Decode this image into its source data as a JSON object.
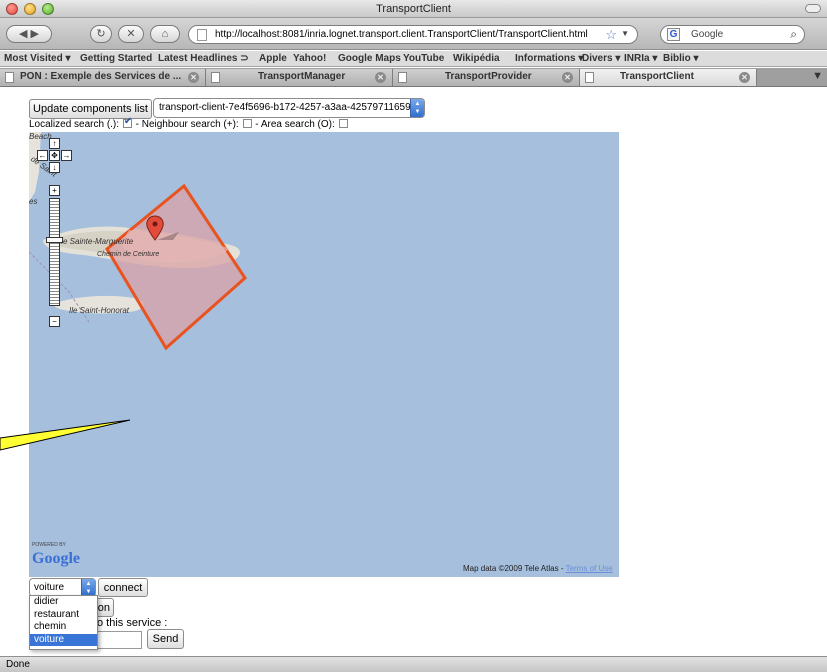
{
  "window": {
    "title": "TransportClient"
  },
  "nav": {
    "url": "http://localhost:8081/inria.lognet.transport.client.TransportClient/TransportClient.html",
    "search_placeholder": "Google",
    "search_engine_glyph": "G"
  },
  "bookmarks": [
    "Most Visited ▾",
    "Getting Started",
    "Latest Headlines ⊃",
    "Apple",
    "Yahoo!",
    "Google Maps",
    "YouTube",
    "Wikipédia",
    "Informations ▾",
    "Divers ▾",
    "INRIa ▾",
    "Biblio ▾"
  ],
  "tabs": [
    {
      "label": "PON : Exemple des Services de ..."
    },
    {
      "label": "TransportManager"
    },
    {
      "label": "TransportProvider"
    },
    {
      "label": "TransportClient"
    }
  ],
  "page": {
    "update_button": "Update components list",
    "component_selected": "transport-client-7e4f5696-b172-4257-a3aa-425797116598",
    "search_options": {
      "localized": "Localized search (.):",
      "neighbour": "- Neighbour search (+):",
      "area": "- Area search (O):"
    },
    "map": {
      "places": [
        "Ile Sainte-Marguerite",
        "Chemin de Ceinture",
        "Ile Saint-Honorat",
        "Beach",
        "de Saint",
        "es"
      ],
      "powered": "POWERED BY",
      "logo": "Google",
      "copyright": "Map data ©2009 Tele Atlas - ",
      "terms": "Terms of Use",
      "controls": {
        "up": "↑",
        "left": "←",
        "center": "✥",
        "right": "→",
        "down": "↓",
        "zoom_in": "+",
        "zoom_out": "−"
      }
    },
    "service": {
      "selected": "voiture",
      "options": [
        "didier",
        "restaurant",
        "chemin",
        "voiture"
      ],
      "connect_button": "connect",
      "disconnect_button": "on",
      "message_label": "o this service :",
      "send_button": "Send"
    }
  },
  "status": {
    "text": "Done"
  },
  "colors": {
    "area_stroke": "#e8531f",
    "area_fill": "#d9a2a6",
    "map_water": "#a5bfdd",
    "select_blue": "#3875d7"
  }
}
